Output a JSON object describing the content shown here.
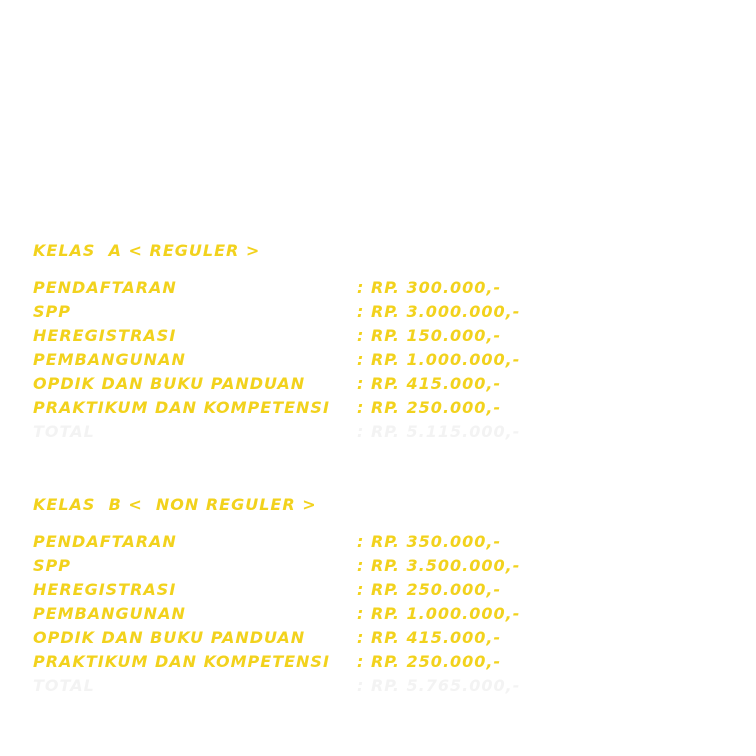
{
  "colors": {
    "text": "#f2d21d",
    "total_text": "#f3f3f3",
    "background": "#ffffff"
  },
  "kelas_a": {
    "heading": "KELAS  A < REGULER >",
    "rows": [
      {
        "label": "PENDAFTARAN",
        "value": ": RP. 300.000,-"
      },
      {
        "label": "SPP",
        "value": ": RP. 3.000.000,-"
      },
      {
        "label": "HEREGISTRASI",
        "value": ": RP. 150.000,-"
      },
      {
        "label": "PEMBANGUNAN",
        "value": ": RP. 1.000.000,-"
      },
      {
        "label": "OPDIK DAN BUKU PANDUAN",
        "value": ": RP. 415.000,-"
      },
      {
        "label": "PRAKTIKUM DAN KOMPETENSI",
        "value": ": RP. 250.000,-"
      }
    ],
    "total": {
      "label": "TOTAL",
      "value": ": RP. 5.115.000,-"
    }
  },
  "kelas_b": {
    "heading": "KELAS  B <  NON REGULER >",
    "rows": [
      {
        "label": "PENDAFTARAN",
        "value": ": RP. 350.000,-"
      },
      {
        "label": "SPP",
        "value": ": RP. 3.500.000,-"
      },
      {
        "label": "HEREGISTRASI",
        "value": ": RP. 250.000,-"
      },
      {
        "label": "PEMBANGUNAN",
        "value": ": RP. 1.000.000,-"
      },
      {
        "label": "OPDIK DAN BUKU PANDUAN",
        "value": ": RP. 415.000,-"
      },
      {
        "label": "PRAKTIKUM DAN KOMPETENSI",
        "value": ": RP. 250.000,-"
      }
    ],
    "total": {
      "label": "TOTAL",
      "value": ": RP. 5.765.000,-"
    }
  }
}
